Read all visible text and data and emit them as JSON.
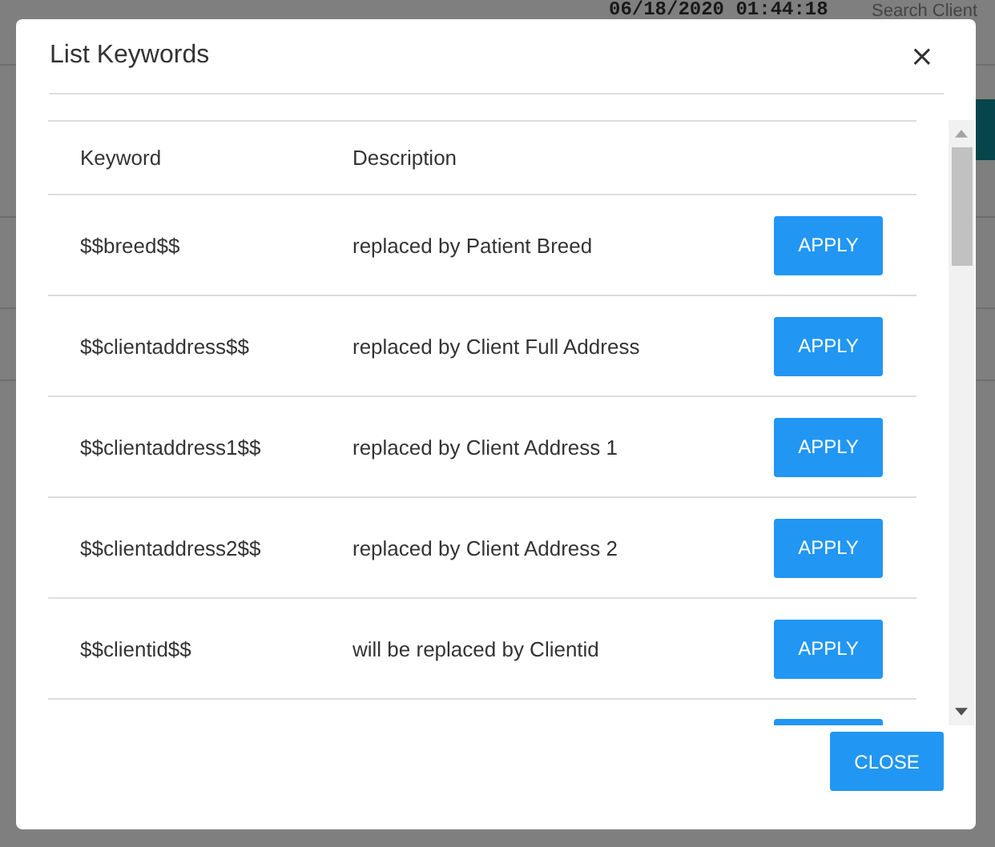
{
  "background": {
    "timestamp": "06/18/2020 01:44:18",
    "search_placeholder": "Search Client"
  },
  "modal": {
    "title": "List Keywords",
    "close_icon": "×",
    "table": {
      "columns": [
        "Keyword",
        "Description"
      ],
      "rows": [
        {
          "keyword": "$$breed$$",
          "description": "replaced by Patient Breed",
          "action": "APPLY"
        },
        {
          "keyword": "$$clientaddress$$",
          "description": "replaced by Client Full Address",
          "action": "APPLY"
        },
        {
          "keyword": "$$clientaddress1$$",
          "description": "replaced by Client Address 1",
          "action": "APPLY"
        },
        {
          "keyword": "$$clientaddress2$$",
          "description": "replaced by Client Address 2",
          "action": "APPLY"
        },
        {
          "keyword": "$$clientid$$",
          "description": "will be replaced by Clientid",
          "action": "APPLY"
        }
      ]
    },
    "footer_button": "CLOSE"
  }
}
